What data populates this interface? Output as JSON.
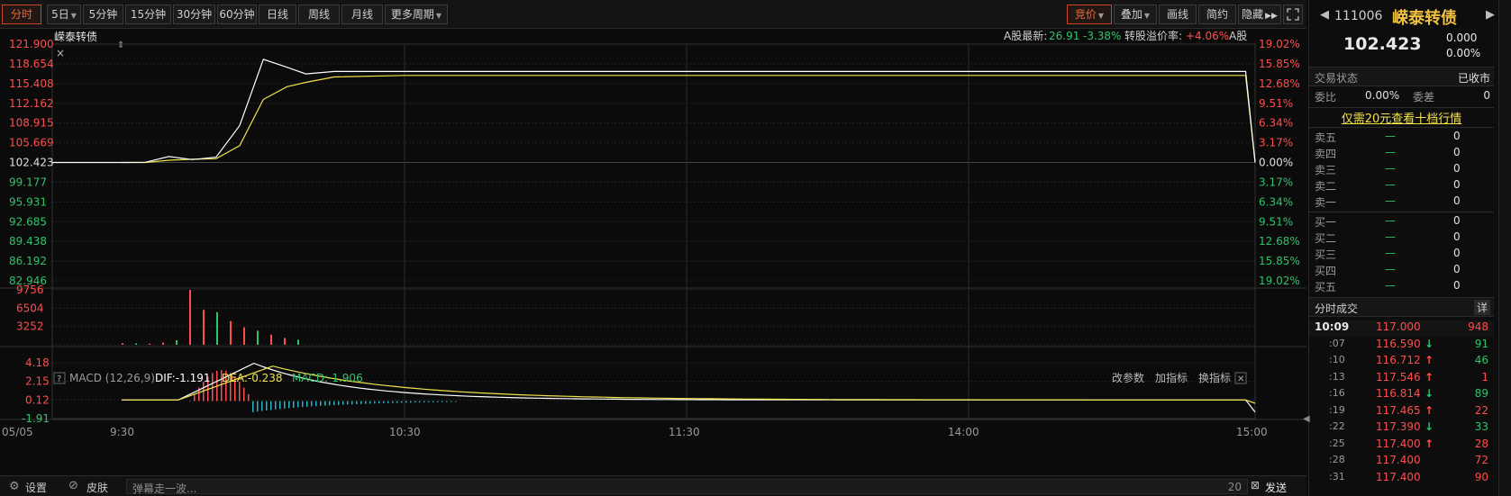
{
  "toolbar": {
    "periods": [
      "分时",
      "5日",
      "5分钟",
      "15分钟",
      "30分钟",
      "60分钟",
      "日线",
      "周线",
      "月线",
      "更多周期"
    ],
    "active_period": "分时",
    "right_buttons": [
      "竞价",
      "叠加",
      "画线",
      "简约",
      "隐藏"
    ],
    "fullscreen_icon": "fullscreen-icon"
  },
  "chart": {
    "name": "嵘泰转债",
    "a_share_label": "A股最新:",
    "a_share_price": "26.91",
    "a_share_change": "-3.38%",
    "premium_label": "转股溢价率:",
    "premium_value": "+4.06%",
    "a_share_tag": "A股",
    "left_prices": [
      "121.900",
      "118.654",
      "115.408",
      "112.162",
      "108.915",
      "105.669",
      "102.423",
      "99.177",
      "95.931",
      "92.685",
      "89.438",
      "86.192",
      "82.946"
    ],
    "right_pcts": [
      "19.02%",
      "15.85%",
      "12.68%",
      "9.51%",
      "6.34%",
      "3.17%",
      "0.00%",
      "3.17%",
      "6.34%",
      "9.51%",
      "12.68%",
      "15.85%",
      "19.02%"
    ],
    "volume_labels": [
      "9756",
      "6504",
      "3252"
    ],
    "macd_title": "MACD (12,26,9)",
    "dif": "DIF:-1.191",
    "dea": "DEA:-0.238",
    "macd": "MACD:-1.906",
    "macd_buttons": [
      "改参数",
      "加指标",
      "换指标"
    ],
    "macd_labels": [
      "4.18",
      "2.15",
      "0.12",
      "-1.91"
    ],
    "time_labels": [
      "05/05",
      "9:30",
      "10:30",
      "11:30",
      "14:00",
      "15:00"
    ],
    "colors": {
      "up": "#ff4d4d",
      "down": "#2ec46a",
      "price_line": "#ffffff",
      "avg_line": "#f2e24a",
      "macd_neg": "#27b6c9"
    }
  },
  "chart_data": {
    "type": "line",
    "title": "嵘泰转债",
    "x": [
      "9:30",
      "9:35",
      "9:40",
      "9:45",
      "9:50",
      "9:55",
      "10:00",
      "10:05",
      "10:09",
      "10:15",
      "10:30",
      "11:30",
      "14:00",
      "14:58",
      "15:00"
    ],
    "series": [
      {
        "name": "price",
        "values": [
          102.42,
          102.45,
          103.4,
          102.9,
          103.3,
          108.5,
          119.4,
          118.1,
          117.0,
          117.4,
          117.4,
          117.4,
          117.4,
          117.4,
          102.42
        ]
      },
      {
        "name": "avg",
        "values": [
          102.42,
          102.43,
          102.8,
          102.95,
          103.05,
          105.2,
          112.8,
          114.9,
          115.6,
          116.5,
          116.75,
          116.75,
          116.75,
          116.75,
          102.42
        ]
      }
    ],
    "ylim": [
      82.946,
      121.9
    ],
    "volume": {
      "max": 9756,
      "values": [
        300,
        250,
        200,
        400,
        800,
        9756,
        6200,
        5800,
        4200,
        3100,
        2500,
        1800,
        1200,
        900
      ]
    },
    "macd": {
      "ylim": [
        -1.91,
        4.18
      ],
      "dif_last": -1.191,
      "dea_last": -0.238,
      "macd_last": -1.906
    }
  },
  "rpanel": {
    "code": "111006",
    "name": "嵘泰转债",
    "price": "102.423",
    "change": "0.000",
    "change_pct": "0.00%",
    "status_label": "交易状态",
    "status_value": "已收市",
    "webi_label": "委比",
    "webi_value": "0.00%",
    "wecha_label": "委差",
    "wecha_value": "0",
    "promo": "仅需20元查看十档行情",
    "asks": [
      {
        "label": "卖五",
        "price": "—",
        "vol": "0"
      },
      {
        "label": "卖四",
        "price": "—",
        "vol": "0"
      },
      {
        "label": "卖三",
        "price": "—",
        "vol": "0"
      },
      {
        "label": "卖二",
        "price": "—",
        "vol": "0"
      },
      {
        "label": "卖一",
        "price": "—",
        "vol": "0"
      }
    ],
    "bids": [
      {
        "label": "买一",
        "price": "—",
        "vol": "0"
      },
      {
        "label": "买二",
        "price": "—",
        "vol": "0"
      },
      {
        "label": "买三",
        "price": "—",
        "vol": "0"
      },
      {
        "label": "买四",
        "price": "—",
        "vol": "0"
      },
      {
        "label": "买五",
        "price": "—",
        "vol": "0"
      }
    ],
    "trades_title": "分时成交",
    "trades_detail": "详",
    "trades": [
      {
        "time": "10:09",
        "price": "117.000",
        "arrow": "",
        "vol": "948",
        "color": "up"
      },
      {
        "time": ":07",
        "price": "116.590",
        "arrow": "↓",
        "vol": "91",
        "color": "down"
      },
      {
        "time": ":10",
        "price": "116.712",
        "arrow": "↑",
        "vol": "46",
        "color": "down"
      },
      {
        "time": ":13",
        "price": "117.546",
        "arrow": "↑",
        "vol": "1",
        "color": "up"
      },
      {
        "time": ":16",
        "price": "116.814",
        "arrow": "↓",
        "vol": "89",
        "color": "down"
      },
      {
        "time": ":19",
        "price": "117.465",
        "arrow": "↑",
        "vol": "22",
        "color": "up"
      },
      {
        "time": ":22",
        "price": "117.390",
        "arrow": "↓",
        "vol": "33",
        "color": "down"
      },
      {
        "time": ":25",
        "price": "117.400",
        "arrow": "↑",
        "vol": "28",
        "color": "up"
      },
      {
        "time": ":28",
        "price": "117.400",
        "arrow": "",
        "vol": "72",
        "color": "up"
      },
      {
        "time": ":31",
        "price": "117.400",
        "arrow": "",
        "vol": "90",
        "color": "up"
      }
    ]
  },
  "bottom": {
    "settings": "设置",
    "skin": "皮肤",
    "danmu_placeholder": "弹幕走一波...",
    "danmu_count": "20",
    "send": "发送"
  }
}
